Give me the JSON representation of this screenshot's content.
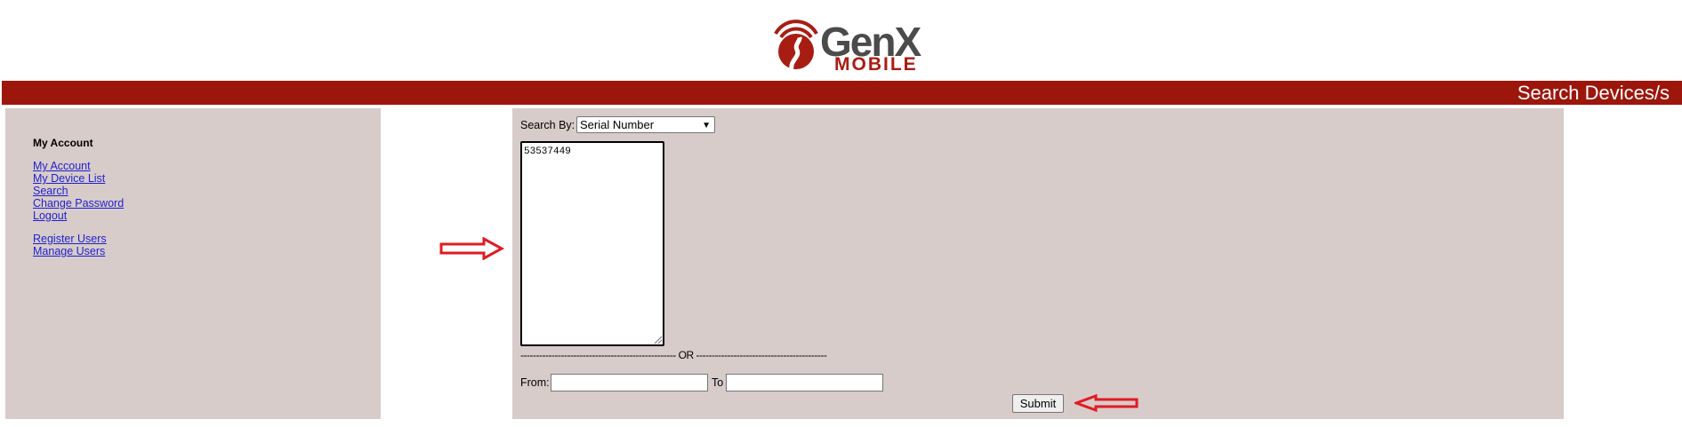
{
  "logo": {
    "gen": "Gen",
    "x": "X",
    "mobile": "MOBILE",
    "icon": "road-signal-icon"
  },
  "header": {
    "title": "Search Devices/s",
    "bar_color": "#9d160c"
  },
  "sidebar": {
    "heading": "My Account",
    "links": [
      "My Account",
      "My Device List",
      "Search",
      "Change Password",
      "Logout"
    ],
    "admin_links": [
      "Register Users",
      "Manage Users"
    ]
  },
  "main": {
    "search_by_label": "Search By:",
    "search_by_value": "Serial Number",
    "serials_value": "53537449",
    "or_separator": "-------------------------------------------------- OR ------------------------------------------",
    "from_label": "From:",
    "from_value": "",
    "to_label": "To",
    "to_value": "",
    "submit_label": "Submit"
  },
  "annotations": {
    "arrow_color": "#e01b24"
  }
}
